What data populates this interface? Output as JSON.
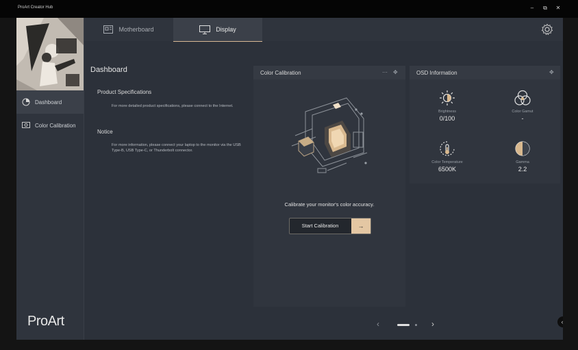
{
  "window": {
    "title": "ProArt Creator Hub",
    "controls": [
      "minimize-icon",
      "restore-icon",
      "close-icon"
    ]
  },
  "sidebar": {
    "items": [
      {
        "label": "Dashboard",
        "icon": "clock-dial-icon",
        "active": true
      },
      {
        "label": "Color Calibration",
        "icon": "monitor-calibration-icon",
        "active": false
      }
    ],
    "brand": "ProArt"
  },
  "tabs": [
    {
      "label": "Motherboard",
      "icon": "motherboard-icon",
      "active": false
    },
    {
      "label": "Display",
      "icon": "monitor-icon",
      "active": true
    }
  ],
  "dashboard": {
    "title": "Dashboard",
    "product_spec_title": "Product Specifications",
    "product_spec_text": "For more detailed product specifications, please connect to the Internet.",
    "notice_title": "Notice",
    "notice_text": "For more information, please connect your laptop to the monitor via the USB Type-B, USB Type-C, or Thunderbolt connector."
  },
  "color_calibration": {
    "title": "Color Calibration",
    "caption": "Calibrate your monitor's color accuracy.",
    "button_label": "Start Calibration"
  },
  "osd": {
    "title": "OSD Information",
    "items": [
      {
        "label": "Brightness",
        "value": "0/100",
        "icon": "sun-icon"
      },
      {
        "label": "Color Gamut",
        "value": "-",
        "icon": "rgb-circles-icon"
      },
      {
        "label": "Color Temperature",
        "value": "6500K",
        "icon": "thermometer-icon"
      },
      {
        "label": "Gamma",
        "value": "2.2",
        "icon": "half-circle-icon"
      }
    ]
  },
  "colors": {
    "accent": "#e4c7a3",
    "background": "#2c313a",
    "panel": "#30353e"
  }
}
